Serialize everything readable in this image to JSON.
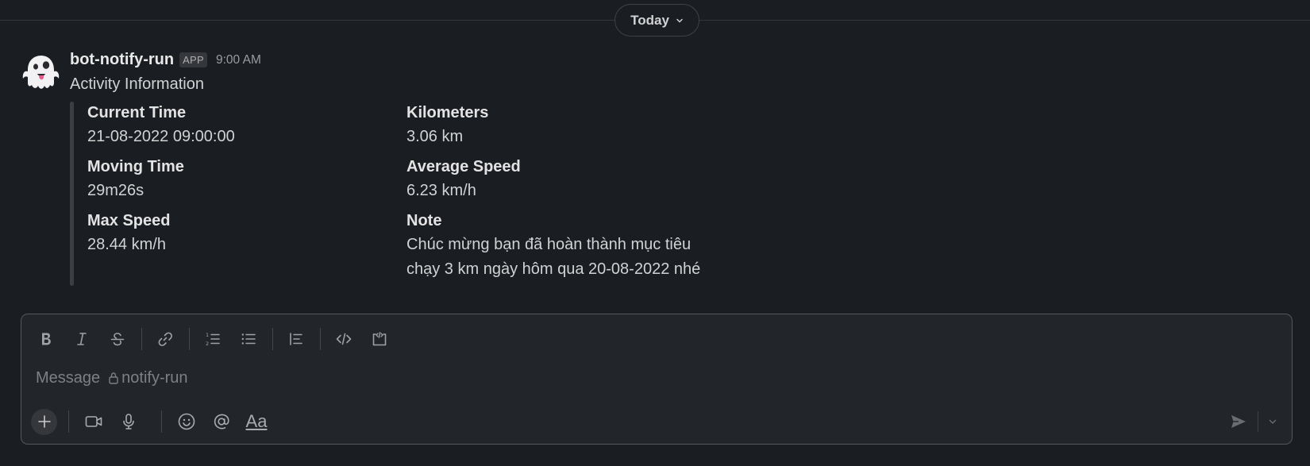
{
  "divider": {
    "date_label": "Today"
  },
  "message": {
    "sender": "bot-notify-run",
    "badge": "APP",
    "time": "9:00 AM",
    "text": "Activity Information",
    "fields": {
      "current_time": {
        "label": "Current Time",
        "value": "21-08-2022 09:00:00"
      },
      "kilometers": {
        "label": "Kilometers",
        "value": "3.06 km"
      },
      "moving_time": {
        "label": "Moving Time",
        "value": "29m26s"
      },
      "average_speed": {
        "label": "Average Speed",
        "value": "6.23 km/h"
      },
      "max_speed": {
        "label": "Max Speed",
        "value": "28.44 km/h"
      },
      "note": {
        "label": "Note",
        "value_line1": "Chúc mừng bạn đã hoàn thành mục tiêu",
        "value_line2": "chạy 3 km ngày hôm qua 20-08-2022 nhé"
      }
    }
  },
  "composer": {
    "placeholder_prefix": "Message",
    "channel": "notify-run",
    "aa_label": "Aa",
    "toolbar_icons": [
      "bold-icon",
      "italic-icon",
      "strikethrough-icon",
      "link-icon",
      "ordered-list-icon",
      "bulleted-list-icon",
      "blockquote-icon",
      "code-icon",
      "code-block-icon"
    ],
    "bottom_icons": [
      "plus-icon",
      "video-icon",
      "microphone-icon",
      "emoji-icon",
      "mention-icon",
      "formatting-icon",
      "send-icon",
      "chevron-down-icon"
    ]
  },
  "colors": {
    "background": "#1a1d21",
    "composer_bg": "#222529",
    "text": "#d1d2d3",
    "muted": "#9b9c9e"
  }
}
